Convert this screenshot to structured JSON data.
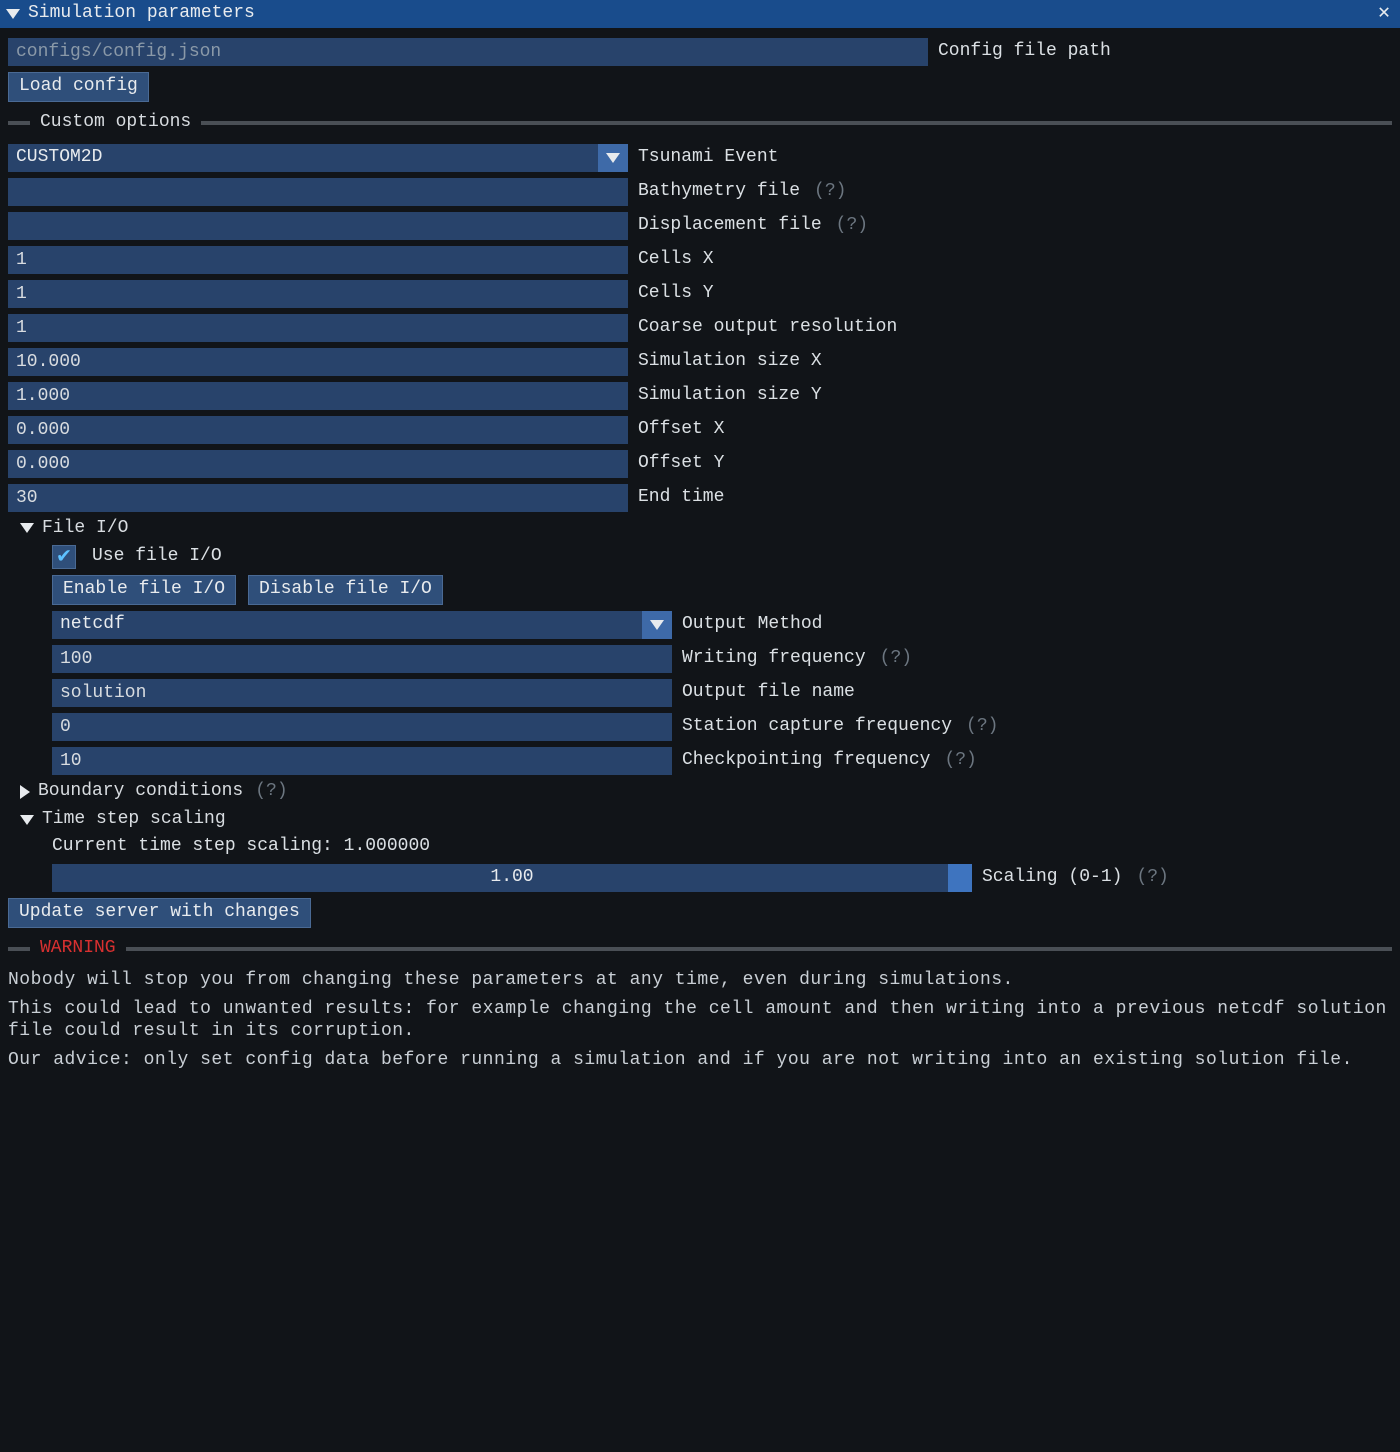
{
  "window": {
    "title": "Simulation parameters"
  },
  "config_path": {
    "value": "configs/config.json",
    "label": "Config file path",
    "load_btn": "Load config"
  },
  "sections": {
    "custom": "Custom options",
    "warning": "WARNING"
  },
  "custom": {
    "event": {
      "value": "CUSTOM2D",
      "label": "Tsunami Event"
    },
    "bathy": {
      "value": "",
      "label": "Bathymetry file",
      "hint": "(?)"
    },
    "disp": {
      "value": "",
      "label": "Displacement file",
      "hint": "(?)"
    },
    "cells_x": {
      "value": "1",
      "label": "Cells X"
    },
    "cells_y": {
      "value": "1",
      "label": "Cells Y"
    },
    "coarse": {
      "value": "1",
      "label": "Coarse output resolution"
    },
    "size_x": {
      "value": "10.000",
      "label": "Simulation size X"
    },
    "size_y": {
      "value": "1.000",
      "label": "Simulation size Y"
    },
    "off_x": {
      "value": "0.000",
      "label": "Offset X"
    },
    "off_y": {
      "value": "0.000",
      "label": "Offset Y"
    },
    "end_time": {
      "value": "30",
      "label": "End time"
    }
  },
  "fileio": {
    "header": "File I/O",
    "use_label": "Use file I/O",
    "enable_btn": "Enable file I/O",
    "disable_btn": "Disable file I/O",
    "method": {
      "value": "netcdf",
      "label": "Output Method"
    },
    "wfreq": {
      "value": "100",
      "label": "Writing frequency",
      "hint": "(?)"
    },
    "outname": {
      "value": "solution",
      "label": "Output file name"
    },
    "station": {
      "value": "0",
      "label": "Station capture frequency",
      "hint": "(?)"
    },
    "ckpt": {
      "value": "10",
      "label": "Checkpointing frequency",
      "hint": "(?)"
    }
  },
  "boundary": {
    "header": "Boundary conditions",
    "hint": "(?)"
  },
  "timestep": {
    "header": "Time step scaling",
    "current": "Current time step scaling: 1.000000",
    "slider_text": "1.00",
    "slider_label": "Scaling (0-1)",
    "hint": "(?)"
  },
  "update_btn": "Update server with changes",
  "warning": {
    "p1": "Nobody will stop you from changing these parameters at any time, even during simulations.",
    "p2": "This could lead to unwanted results: for example changing the cell amount and then writing into a previous netcdf solution file could result in its corruption.",
    "p3": "Our advice: only set config data before running a simulation and if you are not writing into an existing solution file."
  }
}
